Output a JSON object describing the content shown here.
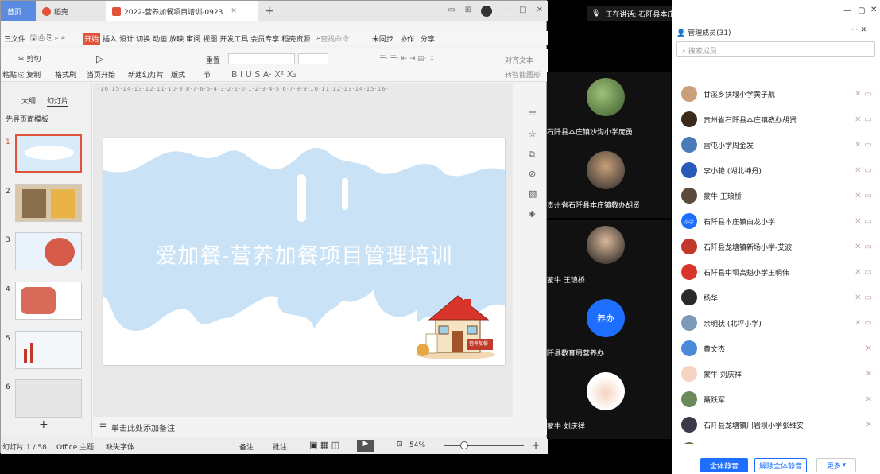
{
  "wps": {
    "tabs": {
      "home": "首页",
      "wps": "稻壳",
      "doc": "2022-营养加餐项目培训-0923"
    },
    "menu": [
      "三文件",
      "开始",
      "插入",
      "设计",
      "切换",
      "动画",
      "放映",
      "审阅",
      "视图",
      "开发工具",
      "会员专享",
      "稻壳资源"
    ],
    "search_placeholder": "查找命令...",
    "menu_right": [
      "未同步",
      "协作",
      "分享"
    ],
    "ribbon": {
      "cut": "剪切",
      "paste": "粘贴",
      "copy": "复制",
      "format": "格式刷",
      "play": "当页开始",
      "new_slide": "新建幻灯片",
      "layout": "版式",
      "section": "节",
      "reset": "重置",
      "text_align": "对齐文本",
      "smart": "转智能图形"
    },
    "pane_tabs": [
      "大纲",
      "幻灯片"
    ],
    "template_label": "先导页面模板",
    "ruler_text": "·16·15·14·13·12·11·10·9·8·7·6·5·4·3·2·1·0·1·2·3·4·5·6·7·8·9·10·11·12·13·14·15·16·",
    "slide_title": "爱加餐-营养加餐项目管理培训",
    "sign_text": "营养加餐",
    "notes_placeholder": "单击此处添加备注",
    "status": {
      "slide": "幻灯片 1 / 58",
      "theme": "Office 主题",
      "font": "缺失字体",
      "notes": "备注",
      "comment": "批注",
      "zoom": "54%"
    },
    "thumb_numbers": [
      "1",
      "2",
      "3",
      "4",
      "5",
      "6"
    ]
  },
  "meeting": {
    "speaking": "正在讲话: 石阡县本庄镇后...",
    "tiles": [
      "石阡县本庄镇沙沟小学庞勇",
      "贵州省石阡县本庄镇教办胡贤",
      "蒙牛 王琅桥",
      "阡县教育局营养办",
      "蒙牛 刘庆祥"
    ],
    "tile4_avatar": "养办"
  },
  "members": {
    "title": "管理成员(31)",
    "search_placeholder": "搜索成员",
    "list": [
      "甘溪乡扶堰小学黄子航",
      "贵州省石阡县本庄镇教办胡贤",
      "雷屯小学周金发",
      "李小艳 (湖北神丹)",
      "蒙牛 王琅桥",
      "石阡县本庄镇白龙小学",
      "石阡县龙塘镇新场小学-艾波",
      "石阡县中坝高魁小学王明伟",
      "杨华",
      "余明状 (北坪小学)",
      "黄文杰",
      "蒙牛 刘庆祥",
      "聂跃军",
      "石阡县龙塘镇川岩坝小学张维安",
      "杨磊"
    ],
    "badge_text": "小学",
    "mute_all": "全体静音",
    "unmute_all": "解除全体静音",
    "more": "更多"
  },
  "colors": {
    "wps_orange": "#e0533a",
    "accent_blue": "#1e6fff",
    "splash": "#c9e2f6"
  }
}
